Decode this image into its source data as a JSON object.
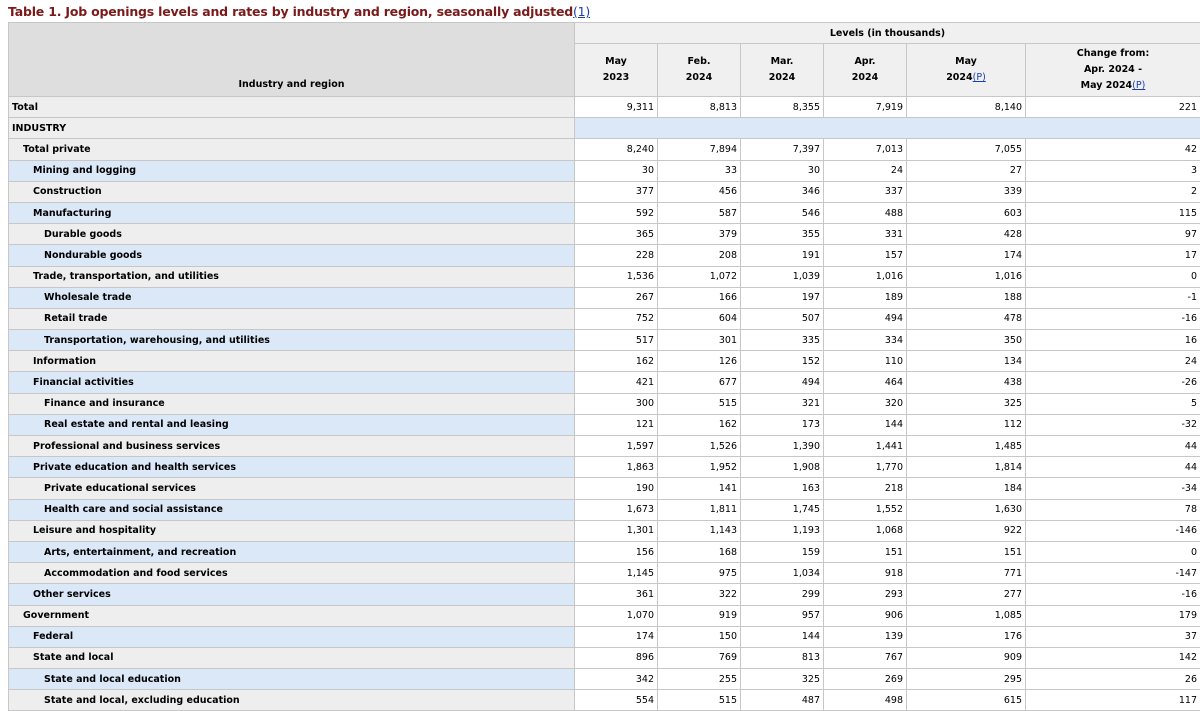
{
  "caption": {
    "text": "Table 1. Job openings levels and rates by industry and region, seasonally adjusted",
    "footnote_link": "(1)"
  },
  "header": {
    "group_label": "Levels (in thousands)",
    "rowhead_label": "Industry and region",
    "columns": [
      {
        "line1": "May",
        "line2": "2023"
      },
      {
        "line1": "Feb.",
        "line2": "2024"
      },
      {
        "line1": "Mar.",
        "line2": "2024"
      },
      {
        "line1": "Apr.",
        "line2": "2024"
      },
      {
        "line1": "May",
        "line2": "2024",
        "link": "(P)"
      }
    ],
    "change": {
      "line1": "Change from:",
      "line2": "Apr. 2024 -",
      "line3": "May 2024",
      "link": "(P)"
    }
  },
  "rows": [
    {
      "label": "Total",
      "indent": 0,
      "values": [
        "9,311",
        "8,813",
        "8,355",
        "7,919",
        "8,140",
        "221"
      ]
    },
    {
      "label": "INDUSTRY",
      "indent": 0,
      "section": true,
      "values": []
    },
    {
      "label": "Total private",
      "indent": 1,
      "values": [
        "8,240",
        "7,894",
        "7,397",
        "7,013",
        "7,055",
        "42"
      ]
    },
    {
      "label": "Mining and logging",
      "indent": 2,
      "values": [
        "30",
        "33",
        "30",
        "24",
        "27",
        "3"
      ]
    },
    {
      "label": "Construction",
      "indent": 2,
      "values": [
        "377",
        "456",
        "346",
        "337",
        "339",
        "2"
      ]
    },
    {
      "label": "Manufacturing",
      "indent": 2,
      "values": [
        "592",
        "587",
        "546",
        "488",
        "603",
        "115"
      ]
    },
    {
      "label": "Durable goods",
      "indent": 3,
      "values": [
        "365",
        "379",
        "355",
        "331",
        "428",
        "97"
      ]
    },
    {
      "label": "Nondurable goods",
      "indent": 3,
      "values": [
        "228",
        "208",
        "191",
        "157",
        "174",
        "17"
      ]
    },
    {
      "label": "Trade, transportation, and utilities",
      "indent": 2,
      "values": [
        "1,536",
        "1,072",
        "1,039",
        "1,016",
        "1,016",
        "0"
      ]
    },
    {
      "label": "Wholesale trade",
      "indent": 3,
      "values": [
        "267",
        "166",
        "197",
        "189",
        "188",
        "-1"
      ]
    },
    {
      "label": "Retail trade",
      "indent": 3,
      "values": [
        "752",
        "604",
        "507",
        "494",
        "478",
        "-16"
      ]
    },
    {
      "label": "Transportation, warehousing, and utilities",
      "indent": 3,
      "values": [
        "517",
        "301",
        "335",
        "334",
        "350",
        "16"
      ]
    },
    {
      "label": "Information",
      "indent": 2,
      "values": [
        "162",
        "126",
        "152",
        "110",
        "134",
        "24"
      ]
    },
    {
      "label": "Financial activities",
      "indent": 2,
      "values": [
        "421",
        "677",
        "494",
        "464",
        "438",
        "-26"
      ]
    },
    {
      "label": "Finance and insurance",
      "indent": 3,
      "values": [
        "300",
        "515",
        "321",
        "320",
        "325",
        "5"
      ]
    },
    {
      "label": "Real estate and rental and leasing",
      "indent": 3,
      "values": [
        "121",
        "162",
        "173",
        "144",
        "112",
        "-32"
      ]
    },
    {
      "label": "Professional and business services",
      "indent": 2,
      "values": [
        "1,597",
        "1,526",
        "1,390",
        "1,441",
        "1,485",
        "44"
      ]
    },
    {
      "label": "Private education and health services",
      "indent": 2,
      "values": [
        "1,863",
        "1,952",
        "1,908",
        "1,770",
        "1,814",
        "44"
      ]
    },
    {
      "label": "Private educational services",
      "indent": 3,
      "values": [
        "190",
        "141",
        "163",
        "218",
        "184",
        "-34"
      ]
    },
    {
      "label": "Health care and social assistance",
      "indent": 3,
      "values": [
        "1,673",
        "1,811",
        "1,745",
        "1,552",
        "1,630",
        "78"
      ]
    },
    {
      "label": "Leisure and hospitality",
      "indent": 2,
      "values": [
        "1,301",
        "1,143",
        "1,193",
        "1,068",
        "922",
        "-146"
      ]
    },
    {
      "label": "Arts, entertainment, and recreation",
      "indent": 3,
      "values": [
        "156",
        "168",
        "159",
        "151",
        "151",
        "0"
      ]
    },
    {
      "label": "Accommodation and food services",
      "indent": 3,
      "values": [
        "1,145",
        "975",
        "1,034",
        "918",
        "771",
        "-147"
      ]
    },
    {
      "label": "Other services",
      "indent": 2,
      "values": [
        "361",
        "322",
        "299",
        "293",
        "277",
        "-16"
      ]
    },
    {
      "label": "Government",
      "indent": 1,
      "values": [
        "1,070",
        "919",
        "957",
        "906",
        "1,085",
        "179"
      ]
    },
    {
      "label": "Federal",
      "indent": 2,
      "values": [
        "174",
        "150",
        "144",
        "139",
        "176",
        "37"
      ]
    },
    {
      "label": "State and local",
      "indent": 2,
      "values": [
        "896",
        "769",
        "813",
        "767",
        "909",
        "142"
      ]
    },
    {
      "label": "State and local education",
      "indent": 3,
      "values": [
        "342",
        "255",
        "325",
        "269",
        "295",
        "26"
      ]
    },
    {
      "label": "State and local, excluding education",
      "indent": 3,
      "values": [
        "554",
        "515",
        "487",
        "498",
        "615",
        "117"
      ]
    }
  ]
}
